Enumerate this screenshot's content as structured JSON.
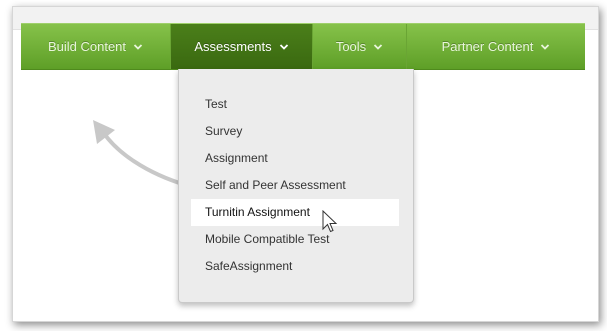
{
  "menubar": {
    "items": [
      {
        "label": "Build Content",
        "active": false
      },
      {
        "label": "Assessments",
        "active": true
      },
      {
        "label": "Tools",
        "active": false
      },
      {
        "label": "Partner Content",
        "active": false
      }
    ]
  },
  "dropdown": {
    "items": [
      {
        "label": "Test"
      },
      {
        "label": "Survey"
      },
      {
        "label": "Assignment"
      },
      {
        "label": "Self and Peer Assessment"
      },
      {
        "label": "Turnitin Assignment",
        "hovered": true
      },
      {
        "label": "Mobile Compatible Test"
      },
      {
        "label": "SafeAssignment"
      }
    ]
  },
  "colors": {
    "menubar": "#6fae34",
    "active": "#447716",
    "dropdown_bg": "#ececec"
  },
  "icons": {
    "chevron": "chevron-down-icon",
    "arrow": "curved-arrow-icon",
    "cursor": "mouse-pointer-icon"
  }
}
